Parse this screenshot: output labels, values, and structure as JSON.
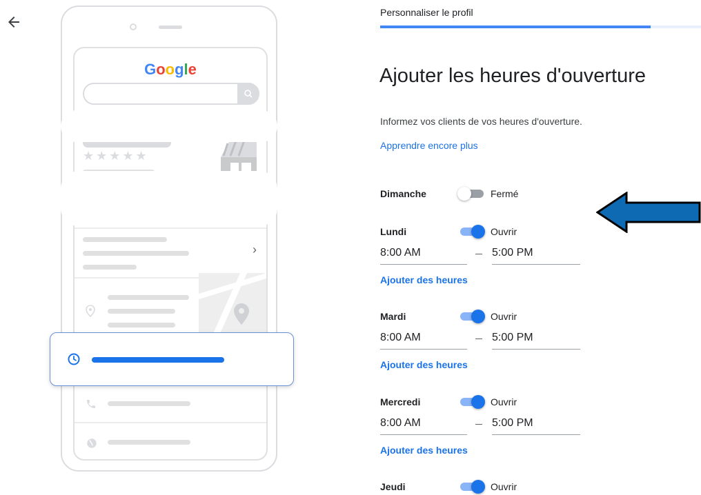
{
  "header": {
    "step_label": "Personnaliser le profil",
    "progress_fraction": 0.844
  },
  "main": {
    "title": "Ajouter les heures d'ouverture",
    "subtitle": "Informez vos clients de vos heures d'ouverture.",
    "learn_more": "Apprendre encore plus",
    "add_hours_label": "Ajouter des heures",
    "days": [
      {
        "name": "Dimanche",
        "open": false,
        "state_label": "Fermé"
      },
      {
        "name": "Lundi",
        "open": true,
        "state_label": "Ouvrir",
        "open_time": "8:00 AM",
        "close_time": "5:00 PM"
      },
      {
        "name": "Mardi",
        "open": true,
        "state_label": "Ouvrir",
        "open_time": "8:00 AM",
        "close_time": "5:00 PM"
      },
      {
        "name": "Mercredi",
        "open": true,
        "state_label": "Ouvrir",
        "open_time": "8:00 AM",
        "close_time": "5:00 PM"
      },
      {
        "name": "Jeudi",
        "open": true,
        "state_label": "Ouvrir"
      }
    ]
  },
  "illustration": {
    "logo_text": "Google",
    "stars": "★★★★★",
    "chevron": "›"
  },
  "colors": {
    "accent": "#1a73e8",
    "track_on": "#8ab4f8",
    "track_off": "#9aa0a6",
    "arrow": "#0f6ab4"
  },
  "icons": {
    "back": "arrow-left-icon",
    "clock": "clock-icon",
    "annotation": "arrow-left-annotation-icon"
  }
}
